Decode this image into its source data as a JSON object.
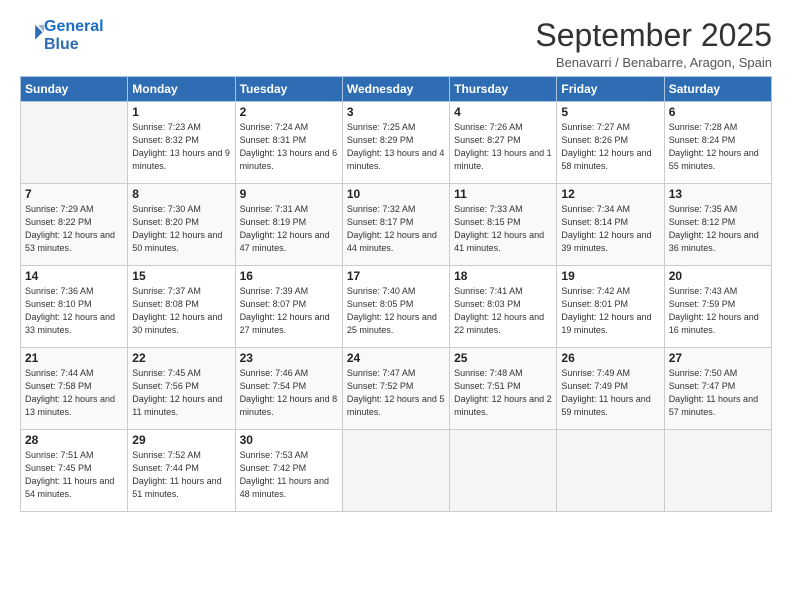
{
  "header": {
    "logo_line1": "General",
    "logo_line2": "Blue",
    "month": "September 2025",
    "location": "Benavarri / Benabarre, Aragon, Spain"
  },
  "days_of_week": [
    "Sunday",
    "Monday",
    "Tuesday",
    "Wednesday",
    "Thursday",
    "Friday",
    "Saturday"
  ],
  "weeks": [
    [
      {
        "day": "",
        "sunrise": "",
        "sunset": "",
        "daylight": ""
      },
      {
        "day": "1",
        "sunrise": "Sunrise: 7:23 AM",
        "sunset": "Sunset: 8:32 PM",
        "daylight": "Daylight: 13 hours and 9 minutes."
      },
      {
        "day": "2",
        "sunrise": "Sunrise: 7:24 AM",
        "sunset": "Sunset: 8:31 PM",
        "daylight": "Daylight: 13 hours and 6 minutes."
      },
      {
        "day": "3",
        "sunrise": "Sunrise: 7:25 AM",
        "sunset": "Sunset: 8:29 PM",
        "daylight": "Daylight: 13 hours and 4 minutes."
      },
      {
        "day": "4",
        "sunrise": "Sunrise: 7:26 AM",
        "sunset": "Sunset: 8:27 PM",
        "daylight": "Daylight: 13 hours and 1 minute."
      },
      {
        "day": "5",
        "sunrise": "Sunrise: 7:27 AM",
        "sunset": "Sunset: 8:26 PM",
        "daylight": "Daylight: 12 hours and 58 minutes."
      },
      {
        "day": "6",
        "sunrise": "Sunrise: 7:28 AM",
        "sunset": "Sunset: 8:24 PM",
        "daylight": "Daylight: 12 hours and 55 minutes."
      }
    ],
    [
      {
        "day": "7",
        "sunrise": "Sunrise: 7:29 AM",
        "sunset": "Sunset: 8:22 PM",
        "daylight": "Daylight: 12 hours and 53 minutes."
      },
      {
        "day": "8",
        "sunrise": "Sunrise: 7:30 AM",
        "sunset": "Sunset: 8:20 PM",
        "daylight": "Daylight: 12 hours and 50 minutes."
      },
      {
        "day": "9",
        "sunrise": "Sunrise: 7:31 AM",
        "sunset": "Sunset: 8:19 PM",
        "daylight": "Daylight: 12 hours and 47 minutes."
      },
      {
        "day": "10",
        "sunrise": "Sunrise: 7:32 AM",
        "sunset": "Sunset: 8:17 PM",
        "daylight": "Daylight: 12 hours and 44 minutes."
      },
      {
        "day": "11",
        "sunrise": "Sunrise: 7:33 AM",
        "sunset": "Sunset: 8:15 PM",
        "daylight": "Daylight: 12 hours and 41 minutes."
      },
      {
        "day": "12",
        "sunrise": "Sunrise: 7:34 AM",
        "sunset": "Sunset: 8:14 PM",
        "daylight": "Daylight: 12 hours and 39 minutes."
      },
      {
        "day": "13",
        "sunrise": "Sunrise: 7:35 AM",
        "sunset": "Sunset: 8:12 PM",
        "daylight": "Daylight: 12 hours and 36 minutes."
      }
    ],
    [
      {
        "day": "14",
        "sunrise": "Sunrise: 7:36 AM",
        "sunset": "Sunset: 8:10 PM",
        "daylight": "Daylight: 12 hours and 33 minutes."
      },
      {
        "day": "15",
        "sunrise": "Sunrise: 7:37 AM",
        "sunset": "Sunset: 8:08 PM",
        "daylight": "Daylight: 12 hours and 30 minutes."
      },
      {
        "day": "16",
        "sunrise": "Sunrise: 7:39 AM",
        "sunset": "Sunset: 8:07 PM",
        "daylight": "Daylight: 12 hours and 27 minutes."
      },
      {
        "day": "17",
        "sunrise": "Sunrise: 7:40 AM",
        "sunset": "Sunset: 8:05 PM",
        "daylight": "Daylight: 12 hours and 25 minutes."
      },
      {
        "day": "18",
        "sunrise": "Sunrise: 7:41 AM",
        "sunset": "Sunset: 8:03 PM",
        "daylight": "Daylight: 12 hours and 22 minutes."
      },
      {
        "day": "19",
        "sunrise": "Sunrise: 7:42 AM",
        "sunset": "Sunset: 8:01 PM",
        "daylight": "Daylight: 12 hours and 19 minutes."
      },
      {
        "day": "20",
        "sunrise": "Sunrise: 7:43 AM",
        "sunset": "Sunset: 7:59 PM",
        "daylight": "Daylight: 12 hours and 16 minutes."
      }
    ],
    [
      {
        "day": "21",
        "sunrise": "Sunrise: 7:44 AM",
        "sunset": "Sunset: 7:58 PM",
        "daylight": "Daylight: 12 hours and 13 minutes."
      },
      {
        "day": "22",
        "sunrise": "Sunrise: 7:45 AM",
        "sunset": "Sunset: 7:56 PM",
        "daylight": "Daylight: 12 hours and 11 minutes."
      },
      {
        "day": "23",
        "sunrise": "Sunrise: 7:46 AM",
        "sunset": "Sunset: 7:54 PM",
        "daylight": "Daylight: 12 hours and 8 minutes."
      },
      {
        "day": "24",
        "sunrise": "Sunrise: 7:47 AM",
        "sunset": "Sunset: 7:52 PM",
        "daylight": "Daylight: 12 hours and 5 minutes."
      },
      {
        "day": "25",
        "sunrise": "Sunrise: 7:48 AM",
        "sunset": "Sunset: 7:51 PM",
        "daylight": "Daylight: 12 hours and 2 minutes."
      },
      {
        "day": "26",
        "sunrise": "Sunrise: 7:49 AM",
        "sunset": "Sunset: 7:49 PM",
        "daylight": "Daylight: 11 hours and 59 minutes."
      },
      {
        "day": "27",
        "sunrise": "Sunrise: 7:50 AM",
        "sunset": "Sunset: 7:47 PM",
        "daylight": "Daylight: 11 hours and 57 minutes."
      }
    ],
    [
      {
        "day": "28",
        "sunrise": "Sunrise: 7:51 AM",
        "sunset": "Sunset: 7:45 PM",
        "daylight": "Daylight: 11 hours and 54 minutes."
      },
      {
        "day": "29",
        "sunrise": "Sunrise: 7:52 AM",
        "sunset": "Sunset: 7:44 PM",
        "daylight": "Daylight: 11 hours and 51 minutes."
      },
      {
        "day": "30",
        "sunrise": "Sunrise: 7:53 AM",
        "sunset": "Sunset: 7:42 PM",
        "daylight": "Daylight: 11 hours and 48 minutes."
      },
      {
        "day": "",
        "sunrise": "",
        "sunset": "",
        "daylight": ""
      },
      {
        "day": "",
        "sunrise": "",
        "sunset": "",
        "daylight": ""
      },
      {
        "day": "",
        "sunrise": "",
        "sunset": "",
        "daylight": ""
      },
      {
        "day": "",
        "sunrise": "",
        "sunset": "",
        "daylight": ""
      }
    ]
  ]
}
